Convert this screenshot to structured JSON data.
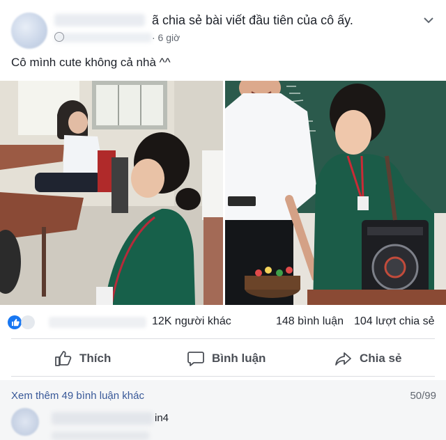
{
  "header": {
    "title": "ã chia sẻ bài viết đầu tiên của cô ấy.",
    "time": "· 6 giờ",
    "globe_icon": "globe-icon",
    "menu_icon": "chevron-down-icon"
  },
  "caption": "Cô mình cute không cả nhà ^^",
  "stats": {
    "likes": "12K người khác",
    "comments": "148 bình luận",
    "shares": "104 lượt chia sẻ"
  },
  "actions": {
    "like_label": "Thích",
    "comment_label": "Bình luận",
    "share_label": "Chia sẻ"
  },
  "comments": {
    "more_label": "Xem thêm 49 bình luận khác",
    "count": "50/99",
    "first_comment_text": "in4"
  },
  "colors": {
    "link": "#385898",
    "secondary_text": "#616770",
    "action_text": "#4b4f56",
    "like_blue": "#1877f2"
  }
}
